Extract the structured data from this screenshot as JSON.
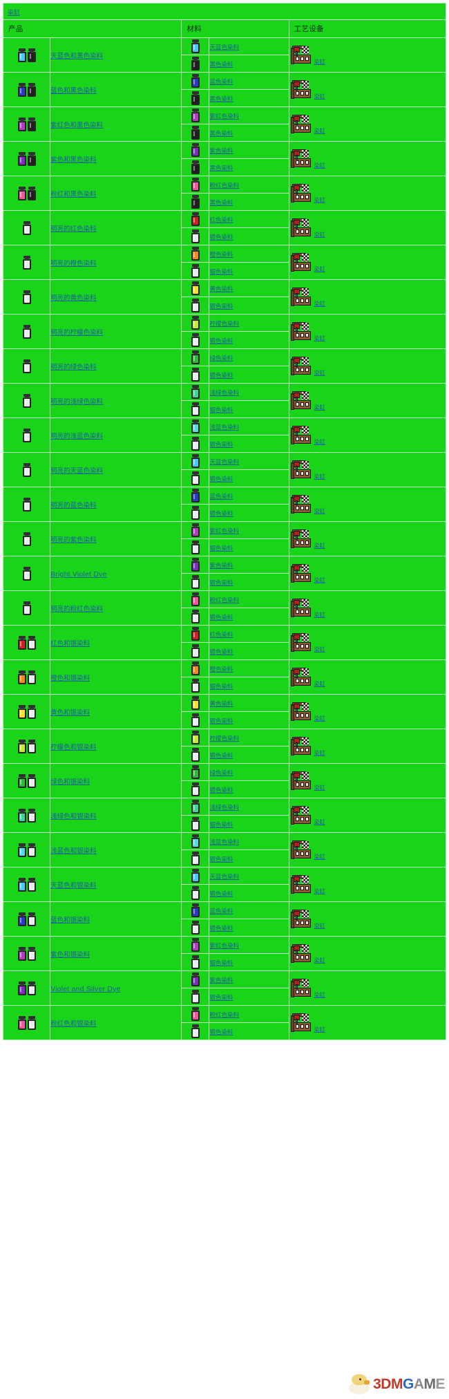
{
  "page": {
    "caption_link": "染缸",
    "watermark": {
      "part1": "3DM",
      "part2": "G",
      "part3": "A",
      "part4": "M",
      "part5": "E"
    }
  },
  "table": {
    "headers": [
      "产品",
      "材料",
      "工艺设备"
    ],
    "station_label": "染缸",
    "rows": [
      {
        "product": "天蓝色和黑色染料",
        "product_icons": [
          "#49c8f5",
          "#1f1f1f"
        ],
        "materials": [
          {
            "name": "天蓝色染料",
            "color": "#49c8f5"
          },
          {
            "name": "黑色染料",
            "color": "#1f1f1f"
          }
        ]
      },
      {
        "product": "蓝色和黑色染料",
        "product_icons": [
          "#2b39c8",
          "#1f1f1f"
        ],
        "materials": [
          {
            "name": "蓝色染料",
            "color": "#2b39c8"
          },
          {
            "name": "黑色染料",
            "color": "#1f1f1f"
          }
        ]
      },
      {
        "product": "紫红色和黑色染料",
        "product_icons": [
          "#b03fc0",
          "#1f1f1f"
        ],
        "materials": [
          {
            "name": "紫红色染料",
            "color": "#b03fc0"
          },
          {
            "name": "黑色染料",
            "color": "#1f1f1f"
          }
        ]
      },
      {
        "product": "紫色和黑色染料",
        "product_icons": [
          "#7b2fc0",
          "#1f1f1f"
        ],
        "materials": [
          {
            "name": "紫色染料",
            "color": "#7b2fc0"
          },
          {
            "name": "黑色染料",
            "color": "#1f1f1f"
          }
        ]
      },
      {
        "product": "粉红和黑色染料",
        "product_icons": [
          "#ec5a9a",
          "#1f1f1f"
        ],
        "materials": [
          {
            "name": "粉红色染料",
            "color": "#ec5a9a"
          },
          {
            "name": "黑色染料",
            "color": "#1f1f1f"
          }
        ]
      },
      {
        "product": "明亮的红色染料",
        "product_icons": [
          "#e8ecef"
        ],
        "materials": [
          {
            "name": "红色染料",
            "color": "#d02020"
          },
          {
            "name": "银色染料",
            "color": "#e8ecef"
          }
        ]
      },
      {
        "product": "明亮的橙色染料",
        "product_icons": [
          "#e8ecef"
        ],
        "materials": [
          {
            "name": "橙色染料",
            "color": "#ef8a1e"
          },
          {
            "name": "银色染料",
            "color": "#e8ecef"
          }
        ]
      },
      {
        "product": "明亮的黄色染料",
        "product_icons": [
          "#e8ecef"
        ],
        "materials": [
          {
            "name": "黄色染料",
            "color": "#f2e02a"
          },
          {
            "name": "银色染料",
            "color": "#e8ecef"
          }
        ]
      },
      {
        "product": "明亮的柠檬色染料",
        "product_icons": [
          "#e8ecef"
        ],
        "materials": [
          {
            "name": "柠檬色染料",
            "color": "#c6e83a"
          },
          {
            "name": "银色染料",
            "color": "#e8ecef"
          }
        ]
      },
      {
        "product": "明亮的绿色染料",
        "product_icons": [
          "#e8ecef"
        ],
        "materials": [
          {
            "name": "绿色染料",
            "color": "#32b83a"
          },
          {
            "name": "银色染料",
            "color": "#e8ecef"
          }
        ]
      },
      {
        "product": "明亮的浅绿色染料",
        "product_icons": [
          "#e8ecef"
        ],
        "materials": [
          {
            "name": "浅绿色染料",
            "color": "#3fd59a"
          },
          {
            "name": "银色染料",
            "color": "#e8ecef"
          }
        ]
      },
      {
        "product": "明亮的浅蓝色染料",
        "product_icons": [
          "#e8ecef"
        ],
        "materials": [
          {
            "name": "浅蓝色染料",
            "color": "#56d8e0"
          },
          {
            "name": "银色染料",
            "color": "#e8ecef"
          }
        ]
      },
      {
        "product": "明亮的天蓝色染料",
        "product_icons": [
          "#e8ecef"
        ],
        "materials": [
          {
            "name": "天蓝色染料",
            "color": "#49c8f5"
          },
          {
            "name": "银色染料",
            "color": "#e8ecef"
          }
        ]
      },
      {
        "product": "明亮的蓝色染料",
        "product_icons": [
          "#e8ecef"
        ],
        "materials": [
          {
            "name": "蓝色染料",
            "color": "#2b39c8"
          },
          {
            "name": "银色染料",
            "color": "#e8ecef"
          }
        ]
      },
      {
        "product": "明亮的紫色染料",
        "product_icons": [
          "#e8ecef"
        ],
        "materials": [
          {
            "name": "紫红色染料",
            "color": "#b03fc0"
          },
          {
            "name": "银色染料",
            "color": "#e8ecef"
          }
        ]
      },
      {
        "product": "Bright Violet Dye",
        "product_en": true,
        "product_icons": [
          "#e8ecef"
        ],
        "materials": [
          {
            "name": "紫色染料",
            "color": "#7b2fc0"
          },
          {
            "name": "银色染料",
            "color": "#e8ecef"
          }
        ]
      },
      {
        "product": "明亮的粉红色染料",
        "product_icons": [
          "#e8ecef"
        ],
        "materials": [
          {
            "name": "粉红色染料",
            "color": "#ec5a9a"
          },
          {
            "name": "银色染料",
            "color": "#e8ecef"
          }
        ]
      },
      {
        "product": "红色和银染料",
        "product_icons": [
          "#d02020",
          "#e8ecef"
        ],
        "materials": [
          {
            "name": "红色染料",
            "color": "#d02020"
          },
          {
            "name": "银色染料",
            "color": "#e8ecef"
          }
        ]
      },
      {
        "product": "橙色和银染料",
        "product_icons": [
          "#ef8a1e",
          "#e8ecef"
        ],
        "materials": [
          {
            "name": "橙色染料",
            "color": "#ef8a1e"
          },
          {
            "name": "银色染料",
            "color": "#e8ecef"
          }
        ]
      },
      {
        "product": "黄色和银染料",
        "product_icons": [
          "#f2e02a",
          "#e8ecef"
        ],
        "materials": [
          {
            "name": "黄色染料",
            "color": "#f2e02a"
          },
          {
            "name": "银色染料",
            "color": "#e8ecef"
          }
        ]
      },
      {
        "product": "柠檬色和银染料",
        "product_icons": [
          "#c6e83a",
          "#e8ecef"
        ],
        "materials": [
          {
            "name": "柠檬色染料",
            "color": "#c6e83a"
          },
          {
            "name": "银色染料",
            "color": "#e8ecef"
          }
        ]
      },
      {
        "product": "绿色和银染料",
        "product_icons": [
          "#32b83a",
          "#e8ecef"
        ],
        "materials": [
          {
            "name": "绿色染料",
            "color": "#32b83a"
          },
          {
            "name": "银色染料",
            "color": "#e8ecef"
          }
        ]
      },
      {
        "product": "浅绿色和银染料",
        "product_icons": [
          "#3fd59a",
          "#e8ecef"
        ],
        "materials": [
          {
            "name": "浅绿色染料",
            "color": "#3fd59a"
          },
          {
            "name": "银色染料",
            "color": "#e8ecef"
          }
        ]
      },
      {
        "product": "浅蓝色和银染料",
        "product_icons": [
          "#56d8e0",
          "#e8ecef"
        ],
        "materials": [
          {
            "name": "浅蓝色染料",
            "color": "#56d8e0"
          },
          {
            "name": "银色染料",
            "color": "#e8ecef"
          }
        ]
      },
      {
        "product": "天蓝色和银染料",
        "product_icons": [
          "#49c8f5",
          "#e8ecef"
        ],
        "materials": [
          {
            "name": "天蓝色染料",
            "color": "#49c8f5"
          },
          {
            "name": "银色染料",
            "color": "#e8ecef"
          }
        ]
      },
      {
        "product": "蓝色和银染料",
        "product_icons": [
          "#2b39c8",
          "#e8ecef"
        ],
        "materials": [
          {
            "name": "蓝色染料",
            "color": "#2b39c8"
          },
          {
            "name": "银色染料",
            "color": "#e8ecef"
          }
        ]
      },
      {
        "product": "紫色和银染料",
        "product_icons": [
          "#b03fc0",
          "#e8ecef"
        ],
        "materials": [
          {
            "name": "紫红色染料",
            "color": "#b03fc0"
          },
          {
            "name": "银色染料",
            "color": "#e8ecef"
          }
        ]
      },
      {
        "product": "Violet and Silver Dye",
        "product_en": true,
        "product_icons": [
          "#7b2fc0",
          "#e8ecef"
        ],
        "materials": [
          {
            "name": "紫色染料",
            "color": "#7b2fc0"
          },
          {
            "name": "银色染料",
            "color": "#e8ecef"
          }
        ]
      },
      {
        "product": "粉红色和银染料",
        "product_icons": [
          "#ec5a9a",
          "#e8ecef"
        ],
        "materials": [
          {
            "name": "粉红色染料",
            "color": "#ec5a9a"
          },
          {
            "name": "银色染料",
            "color": "#e8ecef"
          }
        ]
      }
    ]
  }
}
